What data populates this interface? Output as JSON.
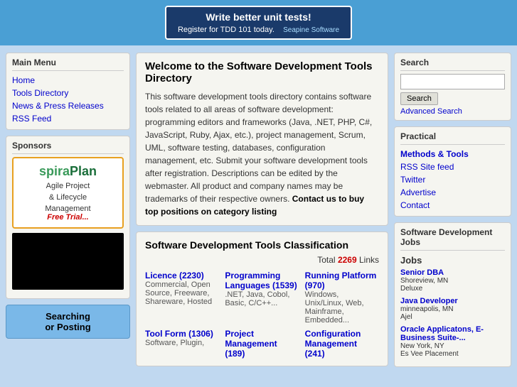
{
  "banner": {
    "line1": "Write better unit tests!",
    "line2": "Register for TDD 101 today.",
    "brand": "Seapine Software"
  },
  "left": {
    "mainMenu": {
      "title": "Main Menu",
      "items": [
        {
          "label": "Home",
          "href": "#"
        },
        {
          "label": "Tools Directory",
          "href": "#"
        },
        {
          "label": "News & Press Releases",
          "href": "#"
        },
        {
          "label": "RSS Feed",
          "href": "#"
        }
      ]
    },
    "sponsors": {
      "title": "Sponsors",
      "ad1": {
        "logo_part1": "spira",
        "logo_part2": "Plan",
        "desc1": "Agile Project",
        "desc2": "& Lifecycle",
        "desc3": "Management",
        "free": "Free Trial..."
      }
    },
    "searchingPosting": {
      "line1": "Searching",
      "line2": "or Posting"
    }
  },
  "center": {
    "welcomeTitle": "Welcome to the Software Development Tools Directory",
    "welcomeText": "This software development tools directory contains software tools related to all areas of software development: programming editors and frameworks (Java, .NET, PHP, C#, JavaScript, Ruby, Ajax, etc.), project management, Scrum, UML, software testing, databases, configuration management, etc. Submit your software development tools after registration. Descriptions can be edited by the webmaster. All product and company names may be trademarks of their respective owners.",
    "contactUs": "Contact us to buy top positions on category listing",
    "classificationTitle": "Software Development Tools Classification",
    "totalLabel": "Total",
    "totalCount": "2269",
    "totalSuffix": "Links",
    "cells": [
      {
        "title": "Licence",
        "count": "(2230)",
        "body": "Commercial, Open Source, Freeware, Shareware, Hosted"
      },
      {
        "title": "Programming Languages",
        "count": "(1539)",
        "body": ".NET, Java, Cobol, Basic, C/C++..."
      },
      {
        "title": "Running Platform",
        "count": "(970)",
        "body": "Windows, Unix/Linux, Web, Mainframe, Embedded..."
      },
      {
        "title": "Tool Form",
        "count": "(1306)",
        "body": "Software, Plugin,"
      },
      {
        "title": "Project Management",
        "count": "(189)",
        "body": ""
      },
      {
        "title": "Configuration Management",
        "count": "(241)",
        "body": ""
      }
    ]
  },
  "right": {
    "search": {
      "title": "Search",
      "placeholder": "",
      "btnLabel": "Search",
      "advancedLabel": "Advanced Search"
    },
    "practical": {
      "title": "Practical",
      "methodsTools": "Methods & Tools",
      "rssSiteFeed": "RSS Site feed",
      "twitter": "Twitter",
      "advertise": "Advertise",
      "contact": "Contact"
    },
    "jobs": {
      "title": "Software Development Jobs",
      "jobsLabel": "Jobs",
      "items": [
        {
          "title": "Senior DBA",
          "location": "Shoreview, MN",
          "company": "Deluxe"
        },
        {
          "title": "Java Developer",
          "location": "minneapolis, MN",
          "company": "Ajel"
        },
        {
          "title": "Oracle Applicatons, E-Business Suite-...",
          "location": "New York, NY",
          "company": "Es Vee Placement"
        }
      ]
    }
  }
}
